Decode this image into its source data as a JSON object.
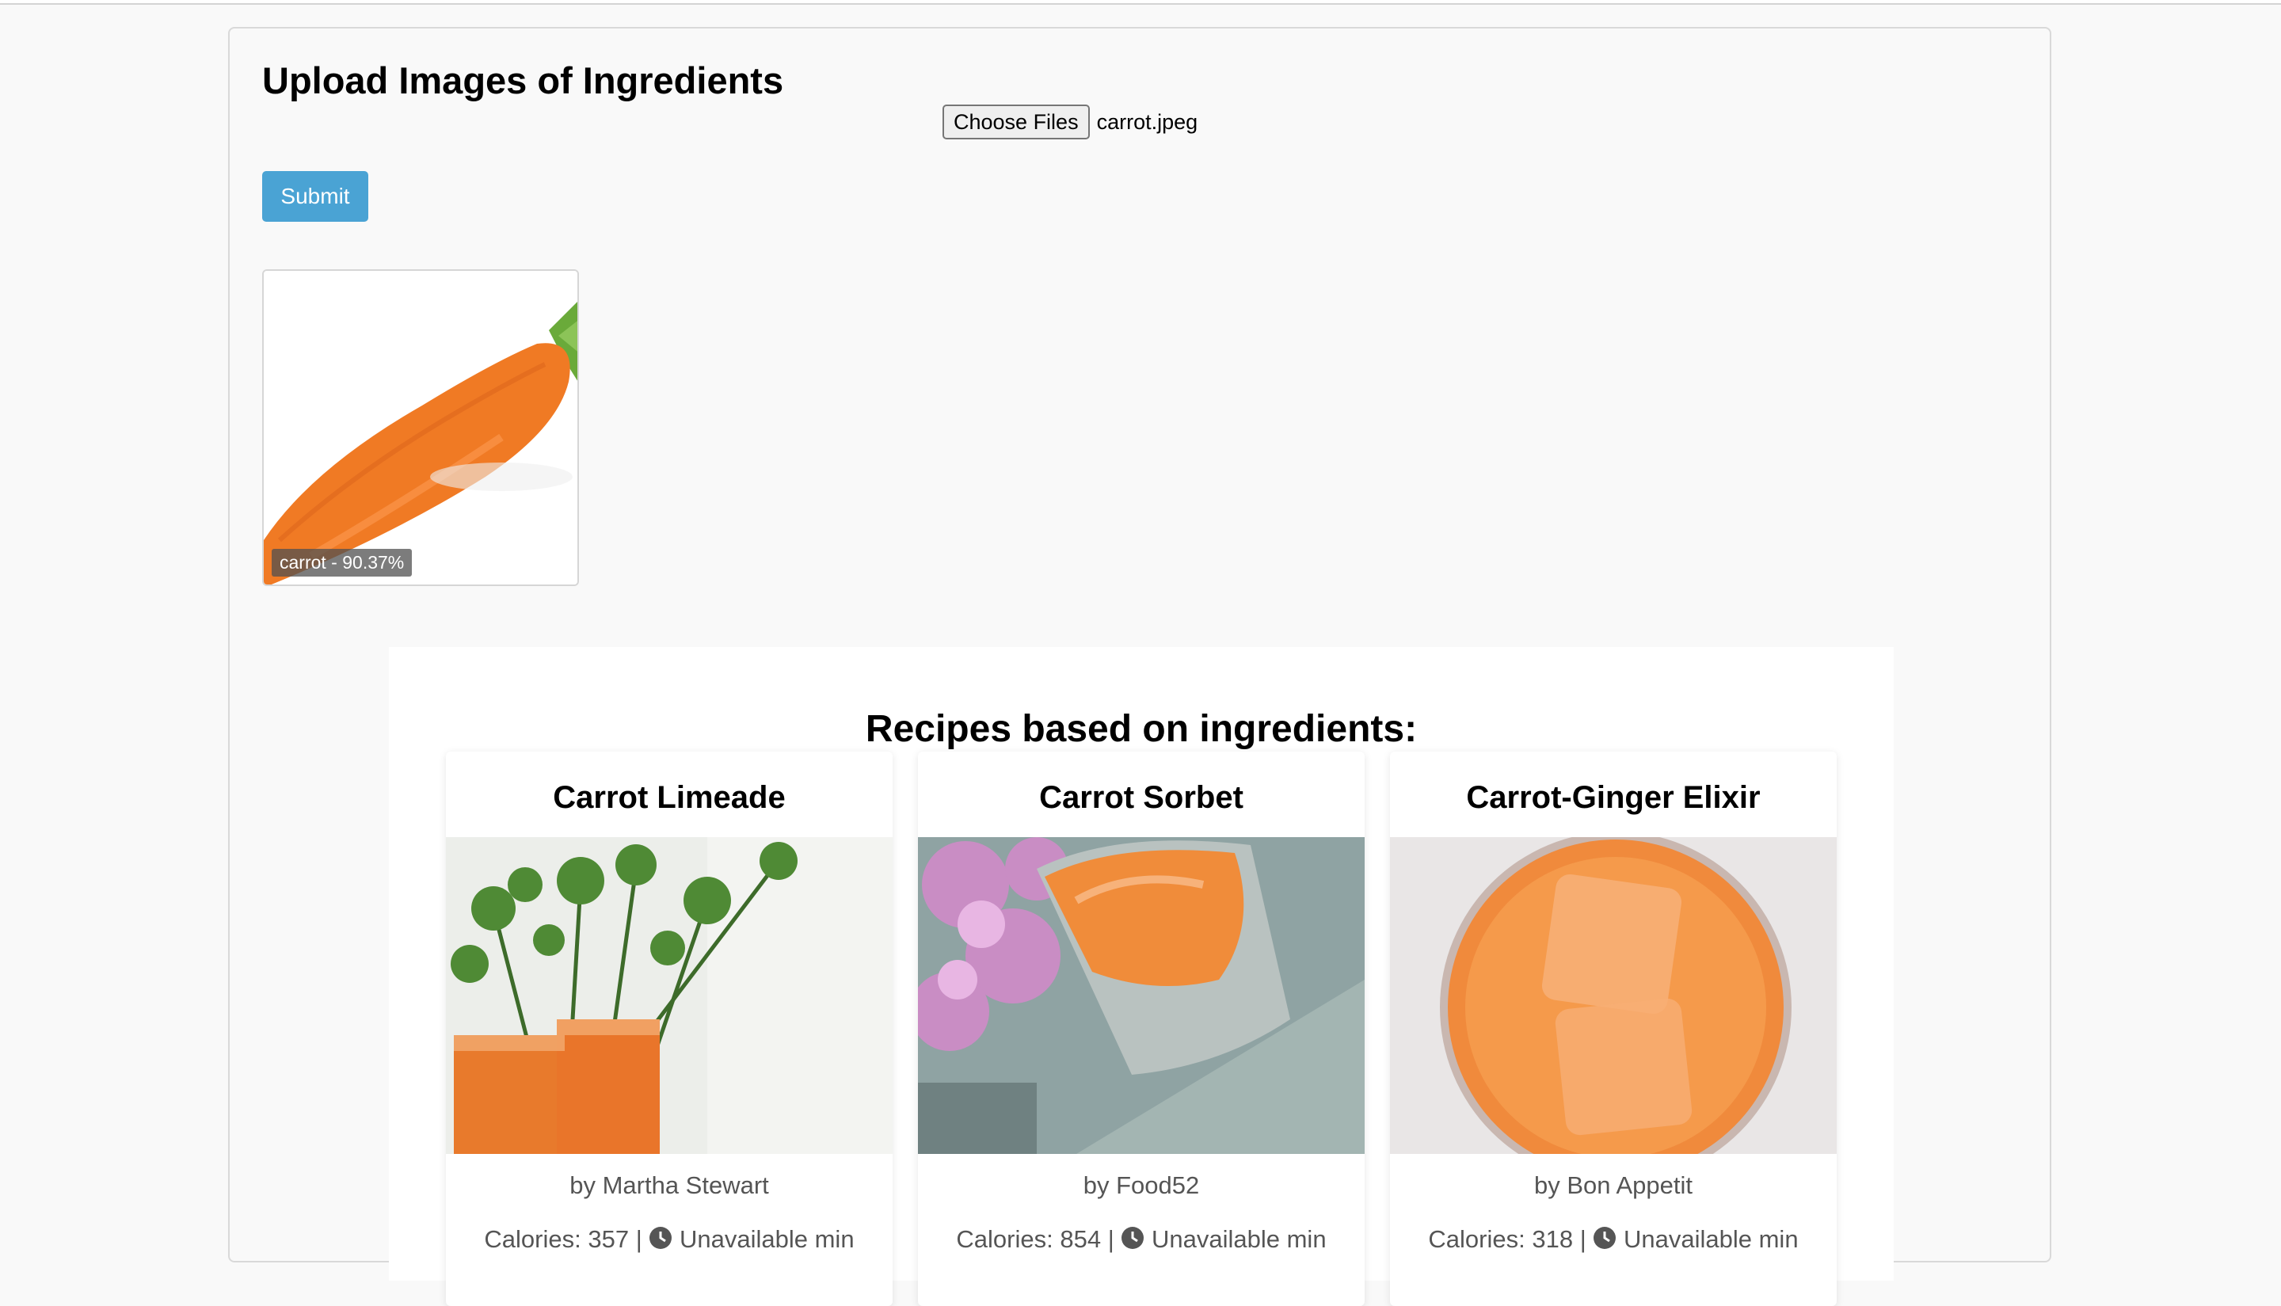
{
  "upload": {
    "title": "Upload Images of Ingredients",
    "choose_label": "Choose Files",
    "file_name": "carrot.jpeg",
    "submit_label": "Submit",
    "prediction_label": "carrot - 90.37%"
  },
  "recipes": {
    "heading": "Recipes based on ingredients:",
    "items": [
      {
        "title": "Carrot Limeade",
        "author": "by Martha Stewart",
        "calories": "Calories: 357 |",
        "time": "Unavailable min"
      },
      {
        "title": "Carrot Sorbet",
        "author": "by Food52",
        "calories": "Calories: 854 |",
        "time": "Unavailable min"
      },
      {
        "title": "Carrot-Ginger Elixir",
        "author": "by Bon Appetit",
        "calories": "Calories: 318 |",
        "time": "Unavailable min"
      }
    ]
  },
  "colors": {
    "accent": "#4aa3d4",
    "carrot": "#f07a24"
  },
  "icons": {
    "time": "clock-icon"
  }
}
